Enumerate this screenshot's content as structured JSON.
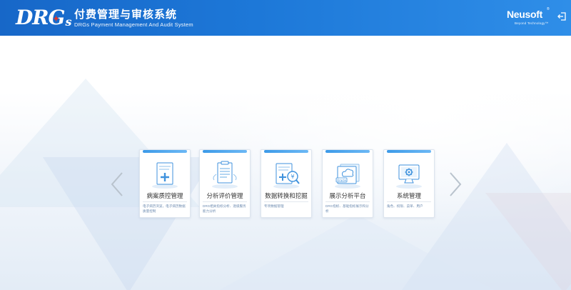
{
  "header": {
    "logo_text": "DRG",
    "logo_suffix": "s",
    "title_zh": "付费管理与审核系统",
    "title_en": "DRGs Payment Management And Audit System",
    "brand": "Neusoft",
    "brand_mark": "®",
    "tagline": "Beyond Technology™",
    "logout_icon": "logout-icon"
  },
  "carousel": {
    "prev_icon": "chevron-left-icon",
    "next_icon": "chevron-right-icon",
    "modules": [
      {
        "name": "病案质控管理",
        "desc": "电子病历浏览，电子病历数据质量控制",
        "icon": "medical-record-icon"
      },
      {
        "name": "分析评价管理",
        "desc": "DRG相关指标分析、逐级服务能力分析",
        "icon": "evaluation-document-icon"
      },
      {
        "name": "数据转换和挖掘",
        "desc": "专项数据管理",
        "icon": "data-mining-icon"
      },
      {
        "name": "展示分析平台",
        "desc": "DRG指标、基础指标展示和分析",
        "icon": "cloud-database-icon"
      },
      {
        "name": "系统管理",
        "desc": "角色、权限、菜单、用户",
        "icon": "system-settings-icon"
      }
    ]
  },
  "colors": {
    "header_start": "#1767c8",
    "header_end": "#2f8ee8",
    "card_accent": "#3c9ae8",
    "desc_text": "#6d8bb0"
  }
}
